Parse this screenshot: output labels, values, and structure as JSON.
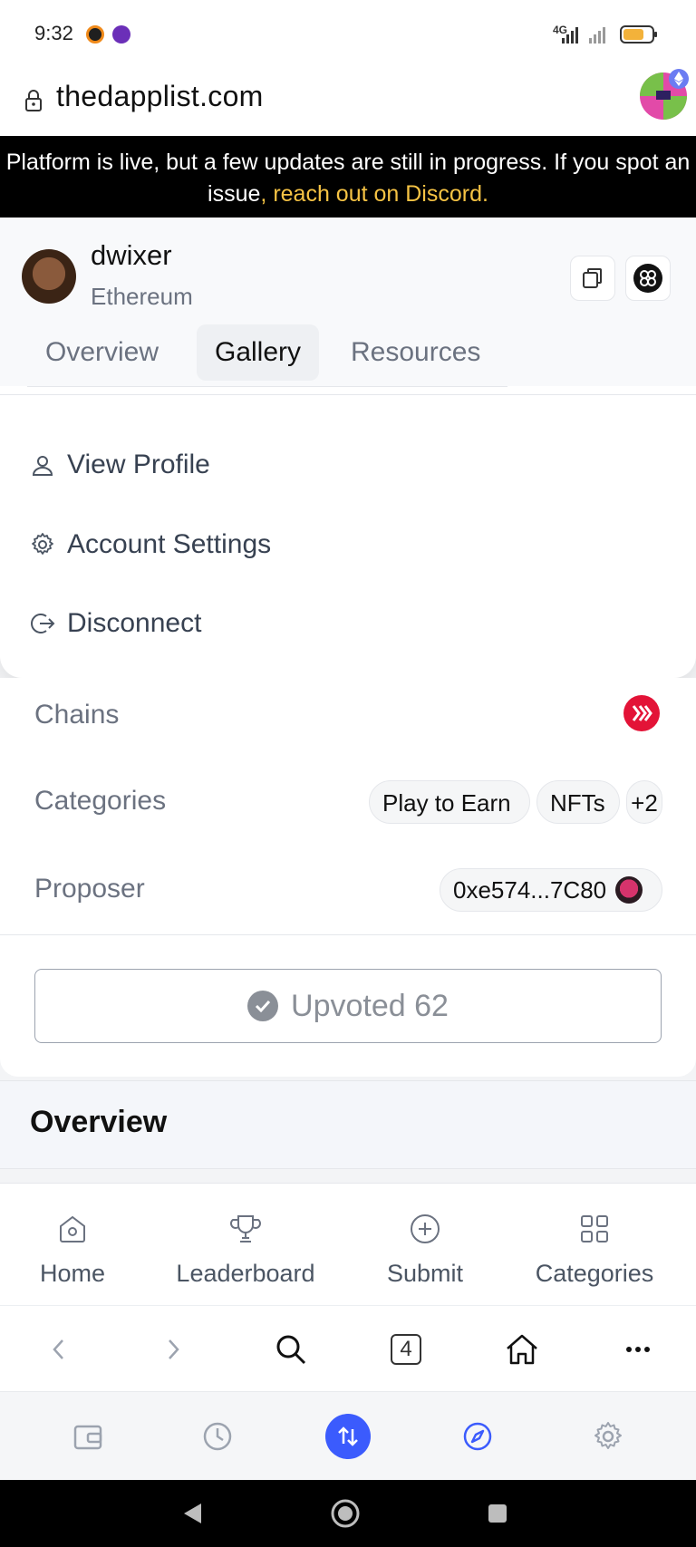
{
  "status_bar": {
    "time": "9:32",
    "network": "4G"
  },
  "url_bar": {
    "url": "thedapplist.com"
  },
  "banner": {
    "text": "Platform is live, but a few updates are still in progress. If you spot an issue",
    "link_text": ", reach out on Discord."
  },
  "profile": {
    "username": "dwixer",
    "network": "Ethereum"
  },
  "tabs": [
    {
      "label": "Overview"
    },
    {
      "label": "Gallery"
    },
    {
      "label": "Resources"
    }
  ],
  "dropdown_menu": [
    {
      "label": "View Profile",
      "icon": "user-icon"
    },
    {
      "label": "Account Settings",
      "icon": "gear-icon"
    },
    {
      "label": "Disconnect",
      "icon": "logout-icon"
    }
  ],
  "details": {
    "chains_label": "Chains",
    "categories_label": "Categories",
    "categories": [
      "Play to Earn",
      "NFTs",
      "+2"
    ],
    "proposer_label": "Proposer",
    "proposer_address": "0xe574...7C80"
  },
  "upvote": {
    "label": "Upvoted 62"
  },
  "overview_section": {
    "title": "Overview"
  },
  "site_nav": [
    {
      "label": "Home",
      "icon": "home-icon"
    },
    {
      "label": "Leaderboard",
      "icon": "trophy-icon"
    },
    {
      "label": "Submit",
      "icon": "plus-circle-icon"
    },
    {
      "label": "Categories",
      "icon": "grid-icon"
    }
  ],
  "browser_toolbar": {
    "tab_count": "4"
  },
  "colors": {
    "banner_bg": "#000000",
    "banner_link": "#f6c344",
    "accent_blue": "#3b5bfd",
    "chain_red": "#e31337"
  }
}
